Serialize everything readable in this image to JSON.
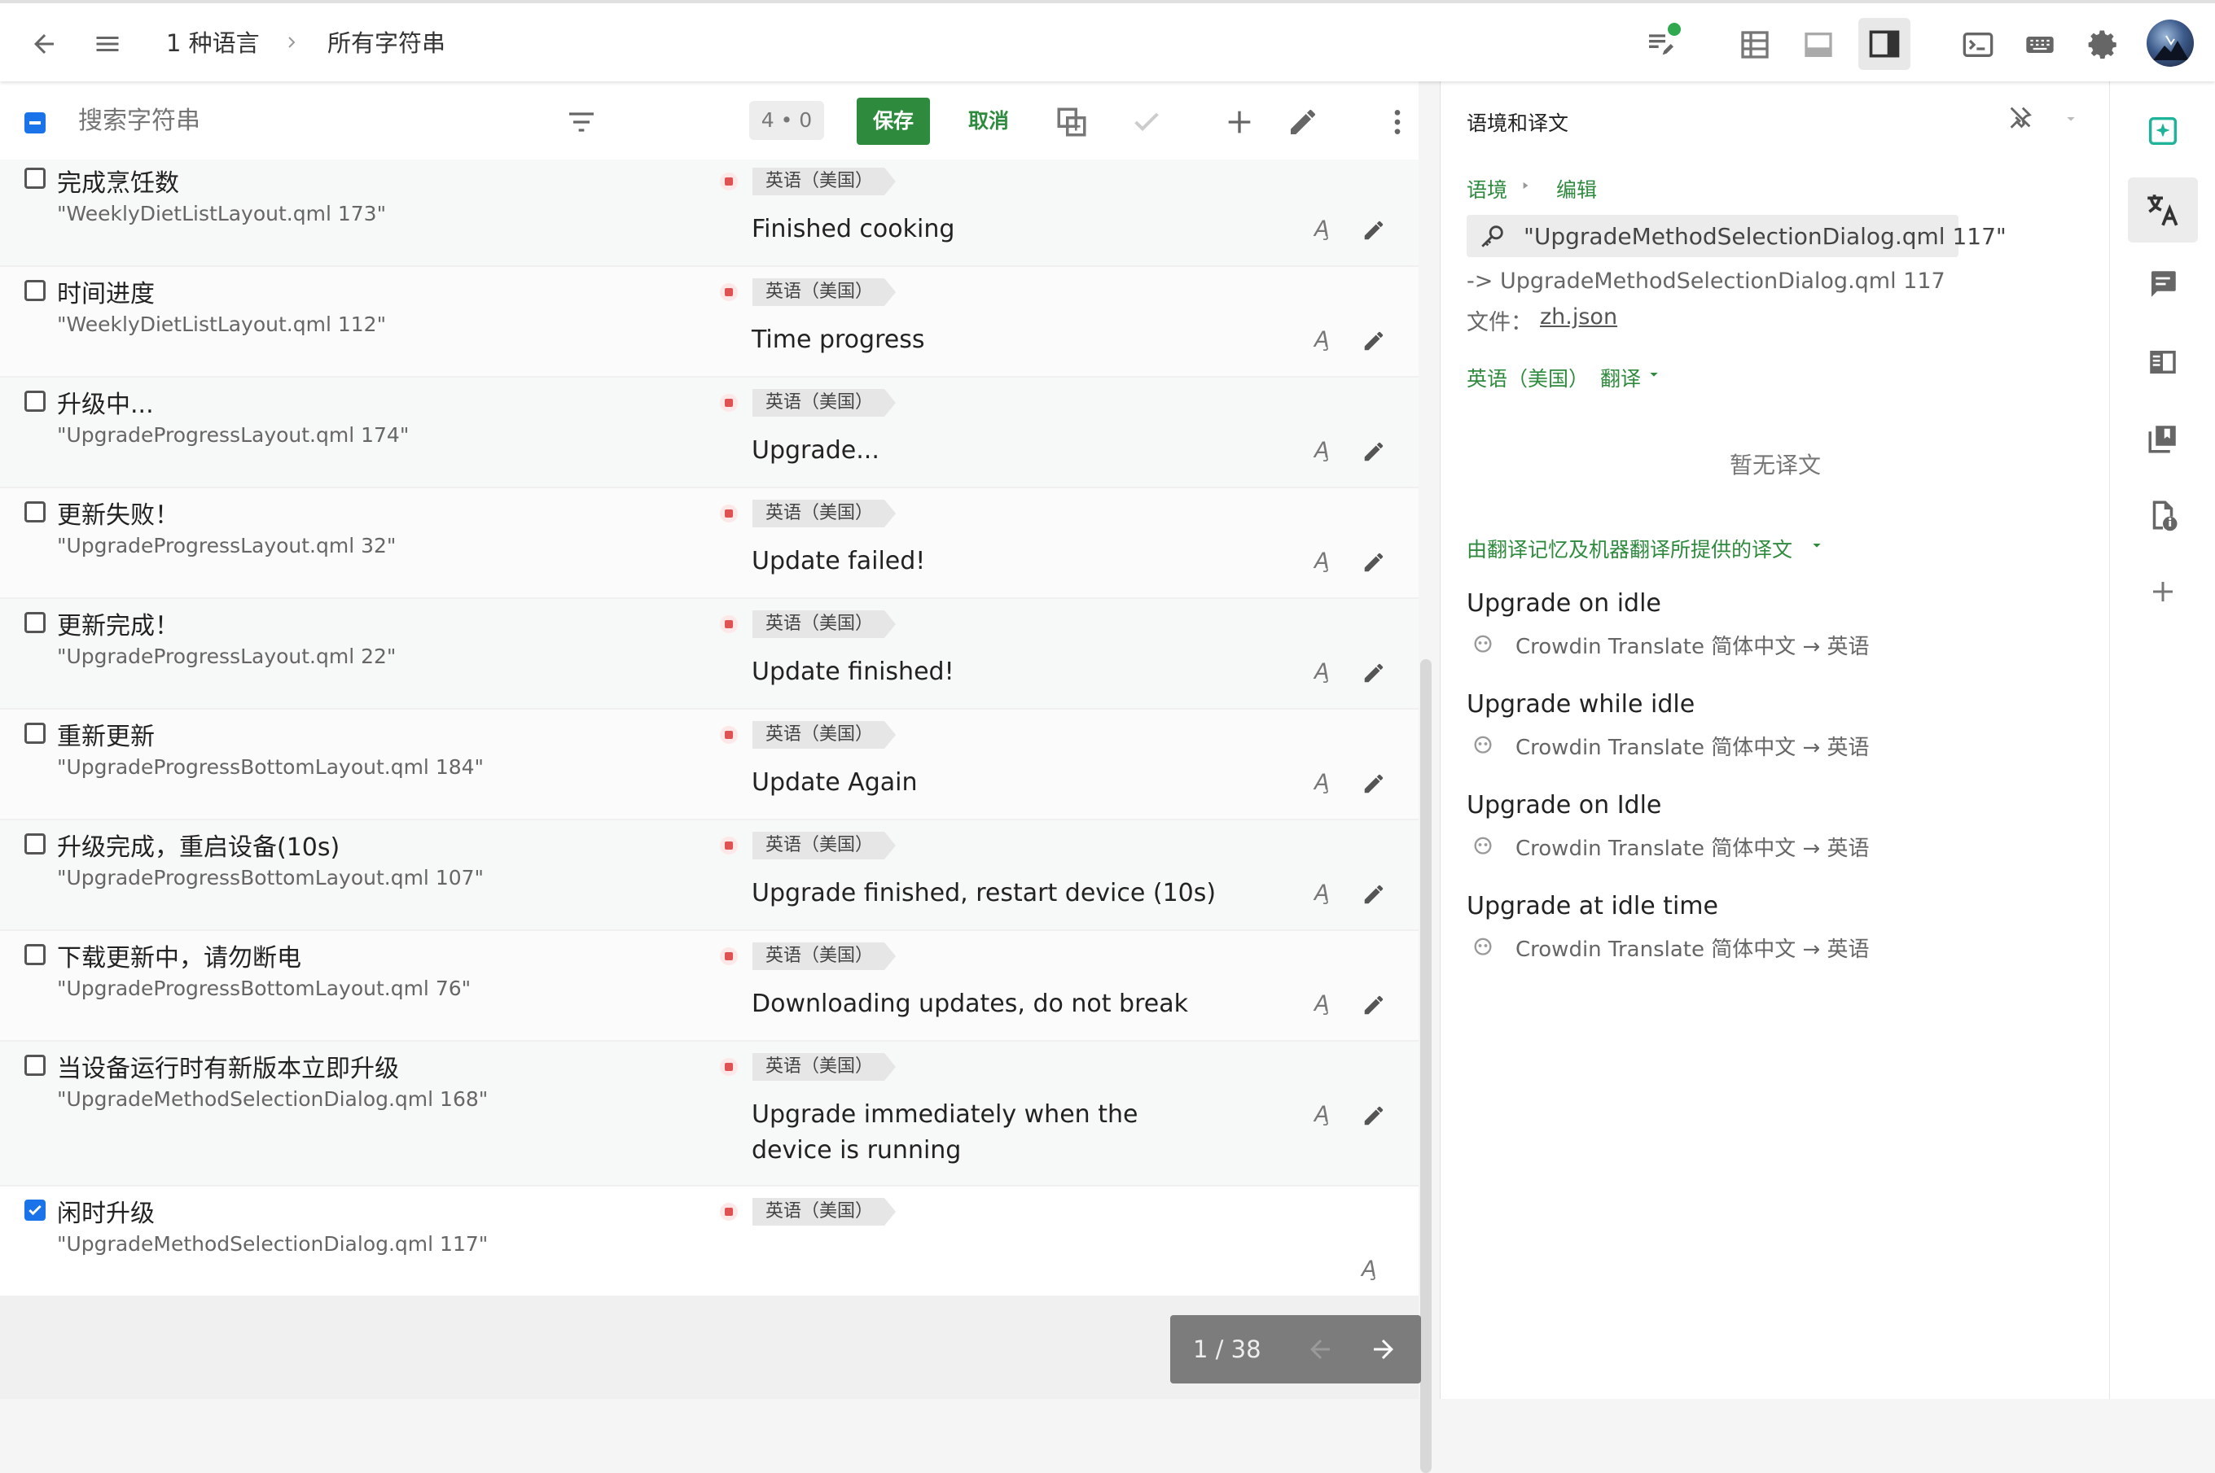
{
  "header": {
    "breadcrumb": [
      "1 种语言",
      "所有字符串"
    ]
  },
  "toolbar": {
    "search_placeholder": "搜索字符串",
    "counter": "4 • 0",
    "save_label": "保存",
    "cancel_label": "取消"
  },
  "rows": [
    {
      "source": "完成烹饪数",
      "context": "\"WeeklyDietListLayout.qml 173\"",
      "language": "英语（美国）",
      "translation": "Finished cooking",
      "checked": false
    },
    {
      "source": "时间进度",
      "context": "\"WeeklyDietListLayout.qml 112\"",
      "language": "英语（美国）",
      "translation": "Time progress",
      "checked": false
    },
    {
      "source": "升级中...",
      "context": "\"UpgradeProgressLayout.qml 174\"",
      "language": "英语（美国）",
      "translation": "Upgrade...",
      "checked": false
    },
    {
      "source": "更新失败！",
      "context": "\"UpgradeProgressLayout.qml 32\"",
      "language": "英语（美国）",
      "translation": "Update failed!",
      "checked": false
    },
    {
      "source": "更新完成！",
      "context": "\"UpgradeProgressLayout.qml 22\"",
      "language": "英语（美国）",
      "translation": "Update finished!",
      "checked": false
    },
    {
      "source": "重新更新",
      "context": "\"UpgradeProgressBottomLayout.qml 184\"",
      "language": "英语（美国）",
      "translation": "Update Again",
      "checked": false
    },
    {
      "source": "升级完成，重启设备(10s)",
      "context": "\"UpgradeProgressBottomLayout.qml 107\"",
      "language": "英语（美国）",
      "translation": "Upgrade finished, restart device (10s)",
      "checked": false
    },
    {
      "source": "下载更新中，请勿断电",
      "context": "\"UpgradeProgressBottomLayout.qml 76\"",
      "language": "英语（美国）",
      "translation": "Downloading updates, do not break",
      "checked": false
    },
    {
      "source": "当设备运行时有新版本立即升级",
      "context": "\"UpgradeMethodSelectionDialog.qml 168\"",
      "language": "英语（美国）",
      "translation": "Upgrade immediately when the device is running",
      "checked": false
    },
    {
      "source": "闲时升级",
      "context": "\"UpgradeMethodSelectionDialog.qml 117\"",
      "language": "英语（美国）",
      "translation": "",
      "checked": true
    }
  ],
  "pager": {
    "label": "1 / 38"
  },
  "panel": {
    "title": "语境和译文",
    "context_link": "语境",
    "edit_link": "编辑",
    "key": "\"UpgradeMethodSelectionDialog.qml 117\"",
    "arrow_ctx": "-> UpgradeMethodSelectionDialog.qml 117",
    "file_label": "文件：",
    "file_name": "zh.json",
    "lang_label": "英语（美国）",
    "trans_label": "翻译",
    "no_translation": "暂无译文",
    "tm_header": "由翻译记忆及机器翻译所提供的译文",
    "suggestions": [
      {
        "text": "Upgrade on idle",
        "source": "Crowdin Translate 简体中文 → 英语"
      },
      {
        "text": "Upgrade while idle",
        "source": "Crowdin Translate 简体中文 → 英语"
      },
      {
        "text": "Upgrade on Idle",
        "source": "Crowdin Translate 简体中文 → 英语"
      },
      {
        "text": "Upgrade at idle time",
        "source": "Crowdin Translate 简体中文 → 英语"
      }
    ]
  },
  "colors": {
    "accent": "#2e8b3e",
    "primary": "#1a73e8",
    "status": "#e05252"
  }
}
